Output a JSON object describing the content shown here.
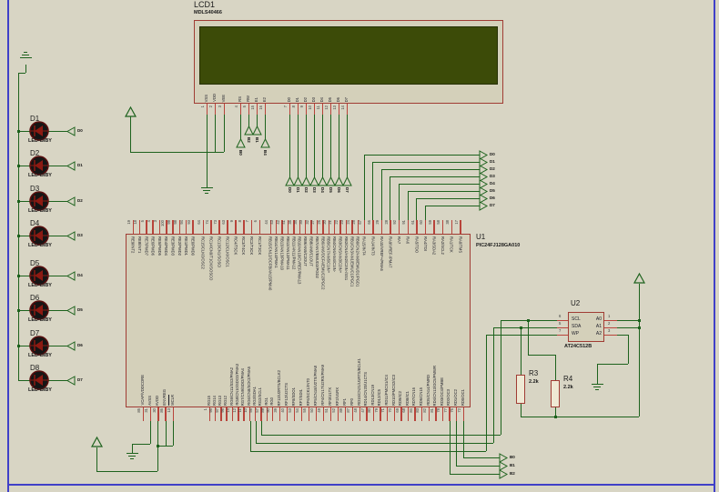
{
  "colors": {
    "background": "#d8d5c4",
    "wire_green": "#1d621d",
    "pin_red": "#b8433a",
    "component_outline": "#a03c34",
    "sheet_border_blue": "#4040c8",
    "lcd_screen": "#3c4b08",
    "led_body": "#151515",
    "led_glyph": "#8c1a12"
  },
  "lcd": {
    "ref": "LCD1",
    "part": "MDLS40466",
    "pins": [
      {
        "name": "VSS",
        "num": "1"
      },
      {
        "name": "VDD",
        "num": "2"
      },
      {
        "name": "VEE",
        "num": "3"
      },
      {
        "name": "RS",
        "num": "4"
      },
      {
        "name": "RW",
        "num": "5"
      },
      {
        "name": "E1",
        "num": "15"
      },
      {
        "name": "E2",
        "num": "16"
      },
      {
        "name": "D0",
        "num": "7"
      },
      {
        "name": "D1",
        "num": "8"
      },
      {
        "name": "D2",
        "num": "9"
      },
      {
        "name": "D3",
        "num": "10"
      },
      {
        "name": "D4",
        "num": "11"
      },
      {
        "name": "D5",
        "num": "12"
      },
      {
        "name": "D6",
        "num": "13"
      },
      {
        "name": "D7",
        "num": "14"
      }
    ]
  },
  "lcd_terminals": {
    "control": [
      "B0",
      "B2",
      "B1",
      "B4"
    ],
    "data": [
      "D0",
      "D1",
      "D2",
      "D3",
      "D4",
      "D5",
      "D6",
      "D7"
    ]
  },
  "leds": {
    "value": "LED-BIBY",
    "items": [
      {
        "ref": "D1",
        "terminal": "D0"
      },
      {
        "ref": "D2",
        "terminal": "D1"
      },
      {
        "ref": "D3",
        "terminal": "D2"
      },
      {
        "ref": "D4",
        "terminal": "D3"
      },
      {
        "ref": "D5",
        "terminal": "D4"
      },
      {
        "ref": "D6",
        "terminal": "D5"
      },
      {
        "ref": "D7",
        "terminal": "D6"
      },
      {
        "ref": "D8",
        "terminal": "D7"
      }
    ]
  },
  "u1": {
    "ref": "U1",
    "part": "PIC24FJ128GA010",
    "top_pin_groups": [
      [
        {
          "name": "RE9/INT2",
          "num": "19"
        },
        {
          "name": "RE8/INT1",
          "num": "18"
        },
        {
          "name": "RE7/PMD7",
          "num": "5"
        },
        {
          "name": "RE6/PMD6",
          "num": "4"
        },
        {
          "name": "RE5/PMD5",
          "num": "3"
        },
        {
          "name": "RE4/PMD4",
          "num": "100"
        },
        {
          "name": "RE3/PMD3",
          "num": "99"
        },
        {
          "name": "RE2/PMD2",
          "num": "98"
        },
        {
          "name": "RE1/PMD1",
          "num": "94"
        },
        {
          "name": "RE0/PMD0",
          "num": "93"
        }
      ],
      [
        {
          "name": "RC15/CLKO/OSC2",
          "num": "64"
        },
        {
          "name": "RC14/CN0/T1CK/SOSCO",
          "num": "74"
        },
        {
          "name": "RC13/CN1/SOSCI",
          "num": "73"
        },
        {
          "name": "RC12/CLKI/OSC1",
          "num": "63"
        },
        {
          "name": "RC4/T5CK",
          "num": "9"
        },
        {
          "name": "RC3/T4CK",
          "num": "8"
        },
        {
          "name": "RC2/T3CK",
          "num": "7"
        },
        {
          "name": "RC1/T2CK",
          "num": "6"
        }
      ],
      [
        {
          "name": "RB15/CN12/OCFB/AN15/PMA0",
          "num": "44"
        },
        {
          "name": "RB14/AN14/PMA1",
          "num": "43"
        },
        {
          "name": "RB13/AN13/PMA10",
          "num": "42"
        },
        {
          "name": "RB12/AN12/PMA11",
          "num": "41"
        },
        {
          "name": "RB11/AN11/PMA12",
          "num": "35"
        },
        {
          "name": "RB10/AN10/CVREF/PMA13",
          "num": "34"
        },
        {
          "name": "RB9/AN9/C2OUT",
          "num": "33"
        },
        {
          "name": "RB8/AN8/C1OUT",
          "num": "32"
        },
        {
          "name": "RB7/AN7/EMUD2/PGD2",
          "num": "27"
        },
        {
          "name": "RB6/AN6/OCFA/EMUC2/PGC2",
          "num": "26"
        },
        {
          "name": "RB5/CN7/AN5/C1IN+",
          "num": "20"
        },
        {
          "name": "RB4/CN6/AN4/C1IN-",
          "num": "21"
        },
        {
          "name": "RB3/CN5/AN3/C2IN+",
          "num": "22"
        },
        {
          "name": "RB2/CN4/AN2/C2IN-/SS1",
          "num": "23"
        },
        {
          "name": "RB1/CN3/AN1/EMUC1/PGC1",
          "num": "24"
        },
        {
          "name": "RB0/CN2/AN0/EMUD1/PGD1",
          "num": "25"
        }
      ],
      [
        {
          "name": "RA15/INT4",
          "num": "67"
        },
        {
          "name": "RA14/INT3",
          "num": "66"
        },
        {
          "name": "RA10/VREF+/PMA6",
          "num": "29"
        },
        {
          "name": "RA9/VREF-/PMA7",
          "num": "28"
        },
        {
          "name": "RA7",
          "num": "92"
        },
        {
          "name": "RA6",
          "num": "91"
        },
        {
          "name": "RA5/TDO",
          "num": "61"
        },
        {
          "name": "RA4/TDI",
          "num": "60"
        },
        {
          "name": "RA3/SDA2",
          "num": "59"
        },
        {
          "name": "RA2/SCL2",
          "num": "58"
        },
        {
          "name": "RA1/TCK",
          "num": "38"
        },
        {
          "name": "RA0/TMS",
          "num": "17"
        }
      ]
    ],
    "bottom_pin_groups": [
      [
        {
          "name": "VCAP/VDDCORE",
          "num": "85"
        },
        {
          "name": "AVSS",
          "num": "31"
        },
        {
          "name": "AVDD",
          "num": "30"
        },
        {
          "name": "ENVREG",
          "num": "86"
        },
        {
          "name": "MCLR",
          "num": "13"
        }
      ],
      [
        {
          "name": "RG15",
          "num": "1"
        },
        {
          "name": "RG14",
          "num": "95"
        },
        {
          "name": "RG13",
          "num": "97"
        },
        {
          "name": "RG12",
          "num": "96"
        },
        {
          "name": "RG9/CN11/SS2/PMA2",
          "num": "14"
        },
        {
          "name": "RG8/CN10/SDO2/PMA3",
          "num": "12"
        },
        {
          "name": "RG7/CN9/SDI2/PMA4",
          "num": "11"
        },
        {
          "name": "RG6/CN8/SCK2/PMA5",
          "num": "10"
        },
        {
          "name": "RG3/SDA1",
          "num": "56"
        },
        {
          "name": "RG2/SCL1",
          "num": "57"
        },
        {
          "name": "RG1",
          "num": "89"
        },
        {
          "name": "RG0",
          "num": "90"
        }
      ],
      [
        {
          "name": "RF13/U2RTS/BCLK2",
          "num": "39"
        },
        {
          "name": "RF12/U2CTS",
          "num": "40"
        },
        {
          "name": "RF8/SDO1",
          "num": "53"
        },
        {
          "name": "RF7/SDI1",
          "num": "54"
        },
        {
          "name": "RF6/SCK1/INT0",
          "num": "55"
        },
        {
          "name": "RF5/CN18/U2TX/PMA8",
          "num": "50"
        },
        {
          "name": "RF4/CN17/U2RX/PMA9",
          "num": "49"
        },
        {
          "name": "RF3/U1TX",
          "num": "51"
        },
        {
          "name": "RF2/U1RX",
          "num": "52"
        },
        {
          "name": "RF1",
          "num": "88"
        },
        {
          "name": "RF0",
          "num": "87"
        }
      ],
      [
        {
          "name": "RD15/CN21/U1RTS/BCLK1",
          "num": "48"
        },
        {
          "name": "RD14/CN20/U1CTS",
          "num": "47"
        },
        {
          "name": "RD13/CN19",
          "num": "80"
        },
        {
          "name": "RD12/IC5",
          "num": "79"
        },
        {
          "name": "RD11/PMCS1/IC4",
          "num": "71"
        },
        {
          "name": "RD10/PMCS2/IC3",
          "num": "70"
        },
        {
          "name": "RD9/IC2",
          "num": "69"
        },
        {
          "name": "RD8/IC1",
          "num": "68"
        },
        {
          "name": "RD7/CN16",
          "num": "84"
        },
        {
          "name": "RD6/CN15",
          "num": "83"
        },
        {
          "name": "RD5/CN14/PMRD",
          "num": "82"
        },
        {
          "name": "RD4/CN13/OC5/PMWR",
          "num": "81"
        },
        {
          "name": "RD3/OC4/PMBE",
          "num": "78"
        },
        {
          "name": "RD2/OC3",
          "num": "77"
        },
        {
          "name": "RD1/OC2",
          "num": "76"
        },
        {
          "name": "RD0/OC1",
          "num": "72"
        }
      ]
    ]
  },
  "mcu_data_terminals": [
    "D0",
    "D1",
    "D2",
    "D3",
    "D4",
    "D5",
    "D6",
    "D7"
  ],
  "u2": {
    "ref": "U2",
    "part": "AT24C512B",
    "left_pins": [
      {
        "name": "SCL",
        "num": "6"
      },
      {
        "name": "SDA",
        "num": "5"
      },
      {
        "name": "WP",
        "num": "7"
      }
    ],
    "right_pins": [
      {
        "name": "A0",
        "num": "1"
      },
      {
        "name": "A1",
        "num": "2"
      },
      {
        "name": "A2",
        "num": "3"
      }
    ]
  },
  "resistors": [
    {
      "ref": "R3",
      "value": "2.2k"
    },
    {
      "ref": "R4",
      "value": "2.2k"
    }
  ],
  "output_terminals": [
    "B0",
    "B1",
    "B2"
  ]
}
